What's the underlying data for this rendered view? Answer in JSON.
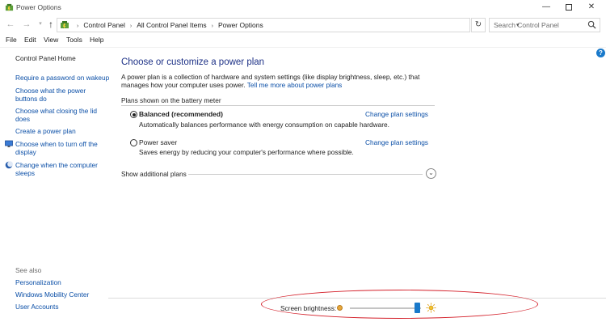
{
  "window": {
    "title": "Power Options",
    "controls": {
      "minimize": "—",
      "close": "✕"
    }
  },
  "address": {
    "crumbs": [
      "Control Panel",
      "All Control Panel Items",
      "Power Options"
    ],
    "search_placeholder": "Search Control Panel"
  },
  "menu": [
    "File",
    "Edit",
    "View",
    "Tools",
    "Help"
  ],
  "sidebar": {
    "home": "Control Panel Home",
    "links": [
      "Require a password on wakeup",
      "Choose what the power buttons do",
      "Choose what closing the lid does",
      "Create a power plan",
      "Choose when to turn off the display",
      "Change when the computer sleeps"
    ],
    "see_also_heading": "See also",
    "see_also": [
      "Personalization",
      "Windows Mobility Center",
      "User Accounts"
    ]
  },
  "main": {
    "title": "Choose or customize a power plan",
    "intro_text": "A power plan is a collection of hardware and system settings (like display brightness, sleep, etc.) that manages how your computer uses power.",
    "intro_link": "Tell me more about power plans",
    "section_heading": "Plans shown on the battery meter",
    "plans": [
      {
        "name": "Balanced (recommended)",
        "description": "Automatically balances performance with energy consumption on capable hardware.",
        "link": "Change plan settings",
        "selected": true
      },
      {
        "name": "Power saver",
        "description": "Saves energy by reducing your computer's performance where possible.",
        "link": "Change plan settings",
        "selected": false
      }
    ],
    "show_more": "Show additional plans"
  },
  "brightness": {
    "label": "Screen brightness:",
    "level": 0.95
  },
  "colors": {
    "link": "#0b4fa7",
    "title": "#1e3287",
    "accent": "#1979ca",
    "highlight_oval": "#d4202a"
  }
}
